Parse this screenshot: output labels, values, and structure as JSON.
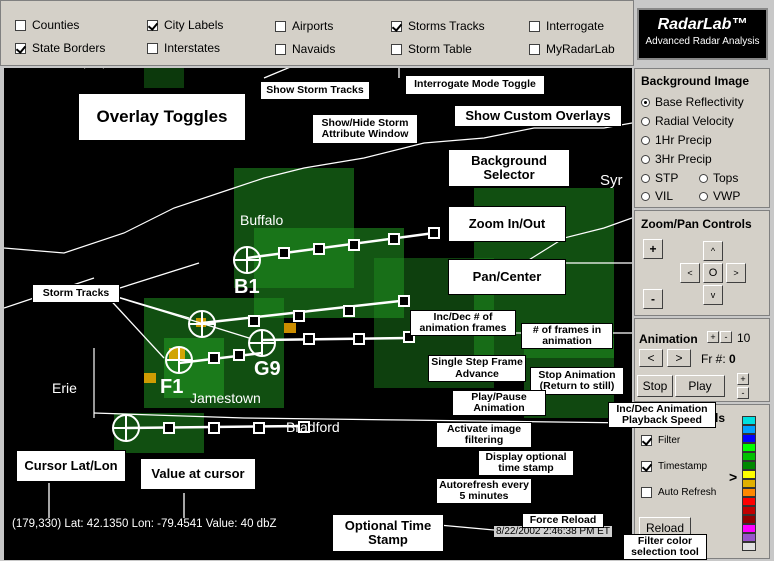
{
  "logo": {
    "name": "RadarLab™",
    "subtitle": "Advanced Radar Analysis"
  },
  "overlays": [
    {
      "label": "Counties",
      "checked": false
    },
    {
      "label": "State Borders",
      "checked": true
    },
    {
      "label": "City Labels",
      "checked": true
    },
    {
      "label": "Interstates",
      "checked": false
    },
    {
      "label": "Airports",
      "checked": false
    },
    {
      "label": "Navaids",
      "checked": false
    },
    {
      "label": "Storms Tracks",
      "checked": true
    },
    {
      "label": "Storm Table",
      "checked": false
    },
    {
      "label": "Interrogate",
      "checked": false
    },
    {
      "label": "MyRadarLab",
      "checked": false
    }
  ],
  "background_image": {
    "title": "Background Image",
    "options": [
      "Base Reflectivity",
      "Radial Velocity",
      "1Hr Precip",
      "3Hr Precip",
      "STP",
      "Tops",
      "VIL",
      "VWP"
    ],
    "selected": "Base Reflectivity"
  },
  "zoom_pan": {
    "title": "Zoom/Pan Controls",
    "zoom_in": "+",
    "zoom_out": "-",
    "up": "^",
    "left": "<",
    "center": "O",
    "right": ">",
    "down": "v"
  },
  "animation": {
    "title": "Animation",
    "frames_inc": "+",
    "frames_dec": "-",
    "frame_count": "10",
    "prev": "<",
    "next": ">",
    "frame_label": "Fr #:",
    "frame_number": "0",
    "stop": "Stop",
    "play": "Play",
    "speed_inc": "+",
    "speed_dec": "-"
  },
  "options": {
    "title_fragment": "ls",
    "filter": {
      "label": "Filter",
      "checked": true
    },
    "timestamp": {
      "label": "Timestamp",
      "checked": true
    },
    "autorefresh": {
      "label": "Auto Refresh",
      "checked": false
    },
    "reload": "Reload"
  },
  "color_scale": {
    "marker": ">",
    "colors": [
      "#00e0e0",
      "#00a0ff",
      "#0000ff",
      "#00ff00",
      "#00c000",
      "#008800",
      "#ffff00",
      "#e0b000",
      "#ff8800",
      "#ff0000",
      "#c00000",
      "#900000",
      "#ff00ff",
      "#9955cc",
      "#e0e0e0"
    ]
  },
  "map": {
    "cities": [
      "Buffalo",
      "Jamestown",
      "Bradford",
      "Erie",
      "Syr"
    ],
    "storm_ids": [
      "B1",
      "F1",
      "G9"
    ],
    "status": "(179,330) Lat: 42.1350  Lon: -79.4541 Value: 40 dbZ",
    "timestamp": "8/22/2002 2:46:38 PM ET"
  },
  "callouts": {
    "overlay_toggles": "Overlay Toggles",
    "show_storm_tracks": "Show Storm Tracks",
    "interrogate_toggle": "Interrogate Mode Toggle",
    "show_hide_storm": "Show/Hide Storm Attribute Window",
    "show_custom": "Show Custom Overlays",
    "background_selector": "Background Selector",
    "zoom_in_out": "Zoom In/Out",
    "pan_center": "Pan/Center",
    "storm_tracks": "Storm Tracks",
    "inc_dec_frames": "Inc/Dec # of animation frames",
    "num_frames": "# of frames in animation",
    "single_step": "Single Step Frame Advance",
    "stop_animation": "Stop Animation (Return to still)",
    "play_pause": "Play/Pause Animation",
    "playback_speed": "Inc/Dec Animation Playback Speed",
    "activate_filter": "Activate image filtering",
    "display_timestamp": "Display optional time stamp",
    "autorefresh": "Autorefresh every 5 minutes",
    "force_reload": "Force Reload",
    "filter_color": "Filter color selection tool",
    "cursor_latlon": "Cursor Lat/Lon",
    "value_cursor": "Value at cursor",
    "optional_timestamp": "Optional Time Stamp"
  }
}
